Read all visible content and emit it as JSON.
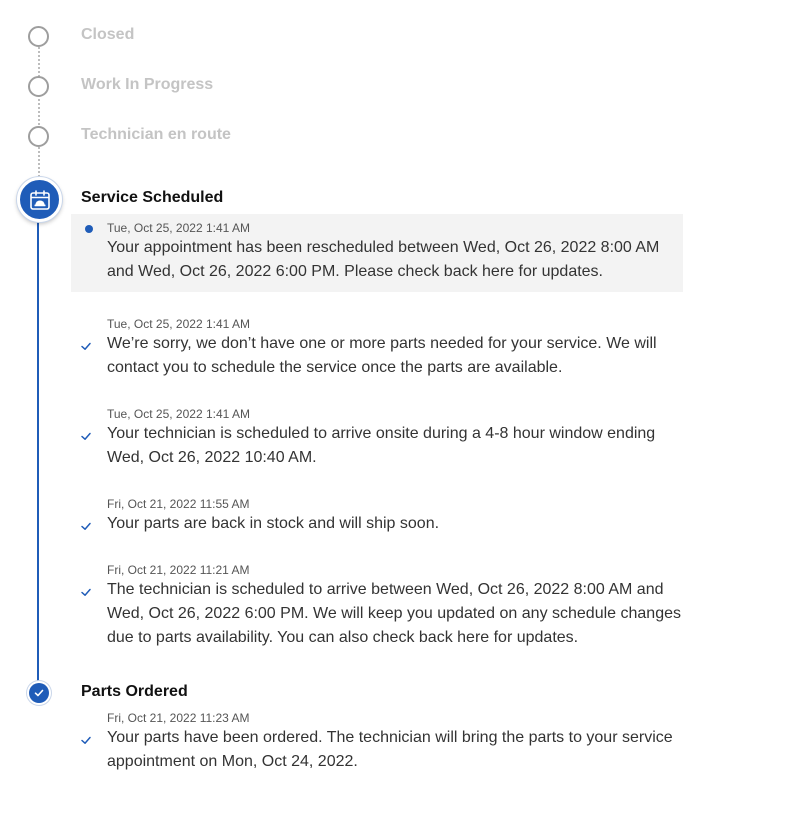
{
  "timeline": {
    "pending_stages": [
      {
        "label": "Closed"
      },
      {
        "label": "Work In Progress"
      },
      {
        "label": "Technician en route"
      }
    ],
    "active_stage": {
      "title": "Service Scheduled",
      "icon": "calendar-technician-icon",
      "entries": [
        {
          "timestamp": "Tue, Oct 25, 2022 1:41 AM",
          "message": "Your appointment has been rescheduled between Wed, Oct 26, 2022 8:00 AM and Wed, Oct 26, 2022 6:00 PM. Please check back here for updates.",
          "marker": "dot"
        },
        {
          "timestamp": "Tue, Oct 25, 2022 1:41 AM",
          "message": "We’re sorry, we don’t have one or more parts needed for your service. We will contact you to schedule the service once the parts are available.",
          "marker": "check"
        },
        {
          "timestamp": "Tue, Oct 25, 2022 1:41 AM",
          "message": "Your technician is scheduled to arrive onsite during a 4-8 hour window ending Wed, Oct 26, 2022 10:40 AM.",
          "marker": "check"
        },
        {
          "timestamp": "Fri, Oct 21, 2022 11:55 AM",
          "message": "Your parts are back in stock and will ship soon.",
          "marker": "check"
        },
        {
          "timestamp": "Fri, Oct 21, 2022 11:21 AM",
          "message": "The technician is scheduled to arrive between Wed, Oct 26, 2022 8:00 AM and Wed, Oct 26, 2022 6:00 PM. We will keep you updated on any schedule changes due to parts availability. You can also check back here for updates.",
          "marker": "check"
        }
      ]
    },
    "completed_stage": {
      "title": "Parts Ordered",
      "icon": "checkmark-icon",
      "entries": [
        {
          "timestamp": "Fri, Oct 21, 2022 11:23 AM",
          "message": "Your parts have been ordered. The technician will bring the parts to your service appointment on Mon, Oct 24, 2022.",
          "marker": "check"
        }
      ]
    }
  },
  "colors": {
    "accent": "#1f5cb8",
    "pending_text": "#c4c4c4",
    "highlight_bg": "#f3f3f3"
  }
}
